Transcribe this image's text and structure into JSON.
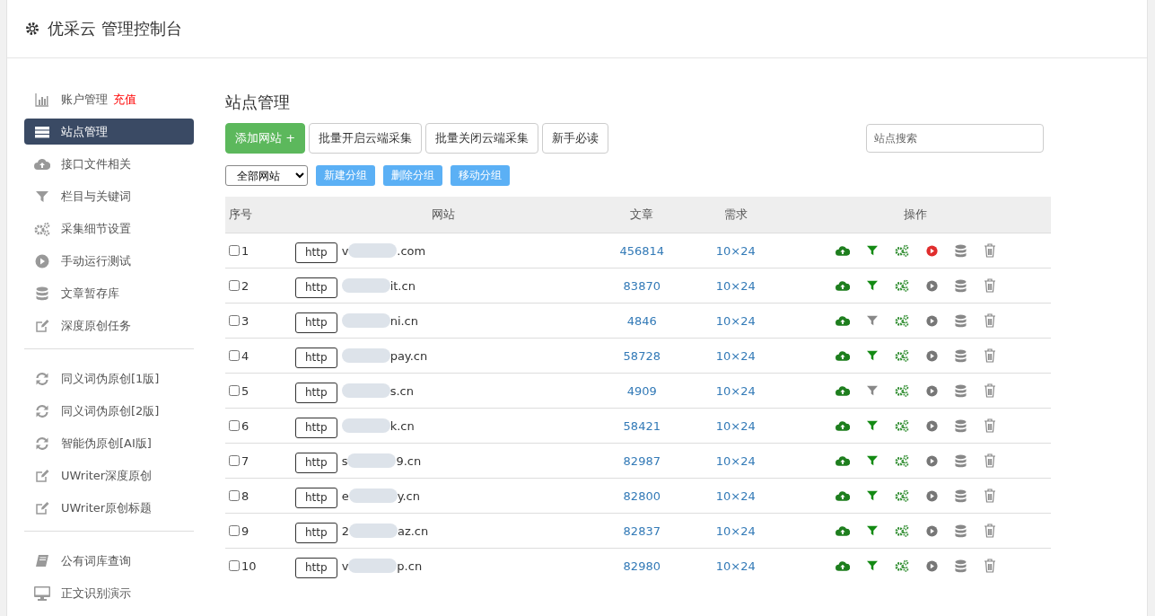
{
  "header": {
    "title": "优采云 管理控制台"
  },
  "sidebar": {
    "groups": [
      {
        "items": [
          {
            "label": "账户管理",
            "badge": "充值",
            "selected": false
          },
          {
            "label": "站点管理",
            "selected": true
          },
          {
            "label": "接口文件相关",
            "selected": false
          },
          {
            "label": "栏目与关键词",
            "selected": false
          },
          {
            "label": "采集细节设置",
            "selected": false
          },
          {
            "label": "手动运行测试",
            "selected": false
          },
          {
            "label": "文章暂存库",
            "selected": false
          },
          {
            "label": "深度原创任务",
            "selected": false
          }
        ]
      },
      {
        "items": [
          {
            "label": "同义词伪原创[1版]",
            "selected": false
          },
          {
            "label": "同义词伪原创[2版]",
            "selected": false
          },
          {
            "label": "智能伪原创[AI版]",
            "selected": false
          },
          {
            "label": "UWriter深度原创",
            "selected": false
          },
          {
            "label": "UWriter原创标题",
            "selected": false
          }
        ]
      },
      {
        "items": [
          {
            "label": "公有词库查询",
            "selected": false
          },
          {
            "label": "正文识别演示",
            "selected": false
          }
        ]
      }
    ]
  },
  "main": {
    "title": "站点管理",
    "toolbar": [
      {
        "label": "添加网站 +",
        "kind": "primary"
      },
      {
        "label": "批量开启云端采集",
        "kind": "default"
      },
      {
        "label": "批量关闭云端采集",
        "kind": "default"
      },
      {
        "label": "新手必读",
        "kind": "default"
      }
    ],
    "search": {
      "placeholder": "站点搜索"
    },
    "group_select": {
      "value": "全部网站"
    },
    "group_buttons": [
      "新建分组",
      "删除分组",
      "移动分组"
    ],
    "table": {
      "columns": [
        "序号",
        "网站",
        "文章",
        "需求",
        "操作"
      ],
      "rows": [
        {
          "no": "1",
          "protocol": "http",
          "domain_start": "v",
          "domain_end": ".com",
          "articles": "456814",
          "demand": "10×24",
          "checked": false,
          "filter_on": true,
          "running": true
        },
        {
          "no": "2",
          "protocol": "http",
          "domain_start": "",
          "domain_end": "it.cn",
          "articles": "83870",
          "demand": "10×24",
          "checked": false,
          "filter_on": true,
          "running": false
        },
        {
          "no": "3",
          "protocol": "http",
          "domain_start": "",
          "domain_end": "ni.cn",
          "articles": "4846",
          "demand": "10×24",
          "checked": false,
          "filter_on": false,
          "running": false
        },
        {
          "no": "4",
          "protocol": "http",
          "domain_start": "",
          "domain_end": "pay.cn",
          "articles": "58728",
          "demand": "10×24",
          "checked": false,
          "filter_on": true,
          "running": false
        },
        {
          "no": "5",
          "protocol": "http",
          "domain_start": "",
          "domain_end": "s.cn",
          "articles": "4909",
          "demand": "10×24",
          "checked": false,
          "filter_on": false,
          "running": false
        },
        {
          "no": "6",
          "protocol": "http",
          "domain_start": "",
          "domain_end": "k.cn",
          "articles": "58421",
          "demand": "10×24",
          "checked": false,
          "filter_on": true,
          "running": false
        },
        {
          "no": "7",
          "protocol": "http",
          "domain_start": "s",
          "domain_end": "9.cn",
          "articles": "82987",
          "demand": "10×24",
          "checked": false,
          "filter_on": true,
          "running": false
        },
        {
          "no": "8",
          "protocol": "http",
          "domain_start": "e",
          "domain_end": "y.cn",
          "articles": "82800",
          "demand": "10×24",
          "checked": false,
          "filter_on": true,
          "running": false
        },
        {
          "no": "9",
          "protocol": "http",
          "domain_start": "2",
          "domain_end": "az.cn",
          "articles": "82837",
          "demand": "10×24",
          "checked": false,
          "filter_on": true,
          "running": false
        },
        {
          "no": "10",
          "protocol": "http",
          "domain_start": "v",
          "domain_end": "p.cn",
          "articles": "82980",
          "demand": "10×24",
          "checked": false,
          "filter_on": true,
          "running": false
        }
      ]
    }
  }
}
